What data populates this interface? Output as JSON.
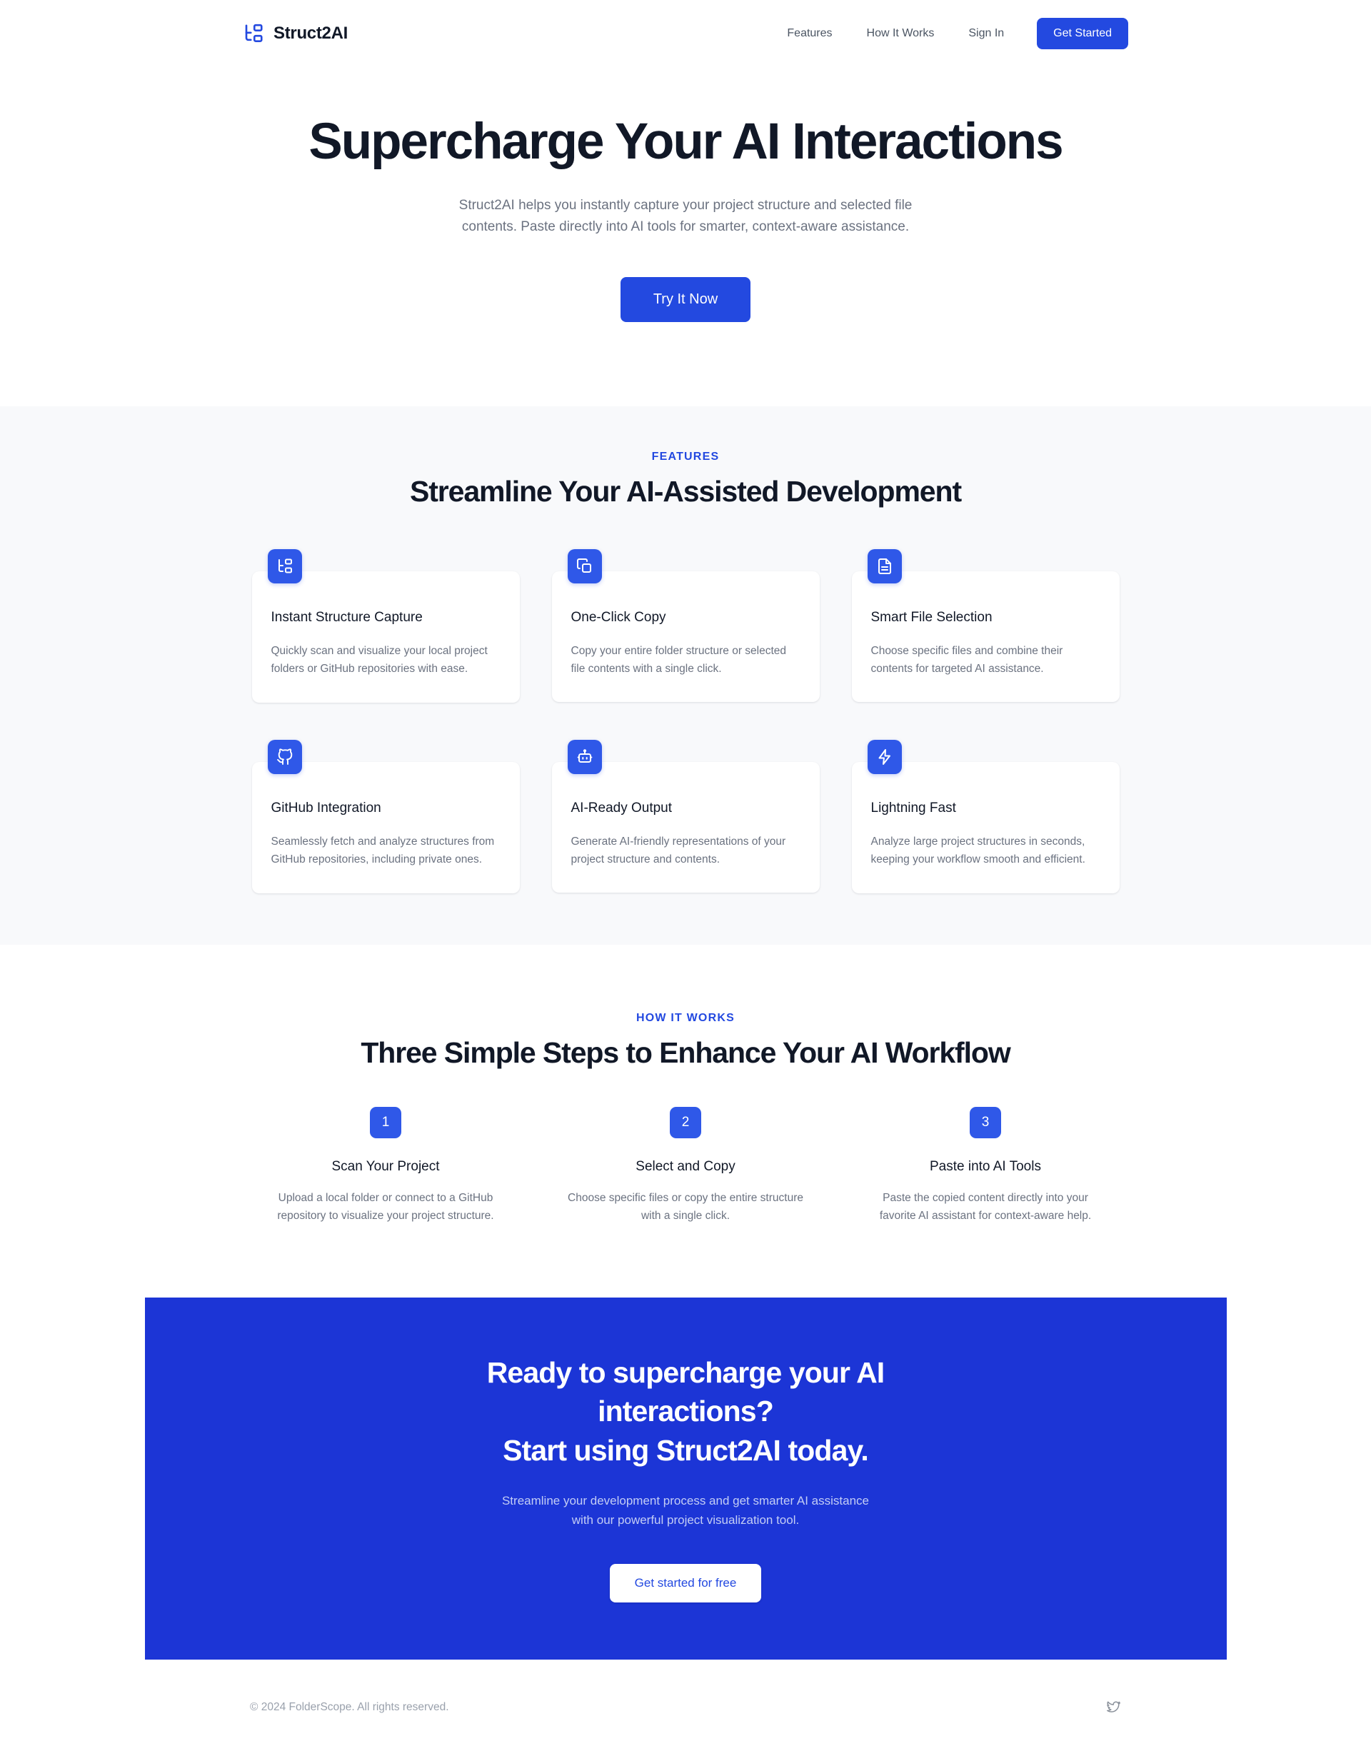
{
  "brand": {
    "name": "Struct2AI",
    "logo_icon": "structure-tree-icon",
    "accent": "#2349e0"
  },
  "nav": {
    "links": [
      {
        "label": "Features"
      },
      {
        "label": "How It Works"
      },
      {
        "label": "Sign In"
      }
    ],
    "cta_label": "Get Started"
  },
  "hero": {
    "title": "Supercharge Your AI Interactions",
    "subtitle": "Struct2AI helps you instantly capture your project structure and selected file contents. Paste directly into AI tools for smarter, context-aware assistance.",
    "cta_label": "Try It Now"
  },
  "features": {
    "eyebrow": "FEATURES",
    "title": "Streamline Your AI-Assisted Development",
    "cards": [
      {
        "icon": "structure-tree-icon",
        "title": "Instant Structure Capture",
        "desc": "Quickly scan and visualize your local project folders or GitHub repositories with ease."
      },
      {
        "icon": "copy-icon",
        "title": "One-Click Copy",
        "desc": "Copy your entire folder structure or selected file contents with a single click."
      },
      {
        "icon": "file-text-icon",
        "title": "Smart File Selection",
        "desc": "Choose specific files and combine their contents for targeted AI assistance."
      },
      {
        "icon": "github-icon",
        "title": "GitHub Integration",
        "desc": "Seamlessly fetch and analyze structures from GitHub repositories, including private ones."
      },
      {
        "icon": "robot-icon",
        "title": "AI-Ready Output",
        "desc": "Generate AI-friendly representations of your project structure and contents."
      },
      {
        "icon": "lightning-bolt-icon",
        "title": "Lightning Fast",
        "desc": "Analyze large project structures in seconds, keeping your workflow smooth and efficient."
      }
    ]
  },
  "how_it_works": {
    "eyebrow": "HOW IT WORKS",
    "title": "Three Simple Steps to Enhance Your AI Workflow",
    "steps": [
      {
        "number": "1",
        "title": "Scan Your Project",
        "desc": "Upload a local folder or connect to a GitHub repository to visualize your project structure."
      },
      {
        "number": "2",
        "title": "Select and Copy",
        "desc": "Choose specific files or copy the entire structure with a single click."
      },
      {
        "number": "3",
        "title": "Paste into AI Tools",
        "desc": "Paste the copied content directly into your favorite AI assistant for context-aware help."
      }
    ]
  },
  "cta": {
    "title_line1": "Ready to supercharge your AI",
    "title_line2": "interactions?",
    "title_line3": "Start using Struct2AI today.",
    "subtitle": "Streamline your development process and get smarter AI assistance with our powerful project visualization tool.",
    "button_label": "Get started for free",
    "background": "#1c35d6"
  },
  "footer": {
    "copyright": "© 2024 FolderScope. All rights reserved.",
    "social_icon": "twitter-icon"
  }
}
